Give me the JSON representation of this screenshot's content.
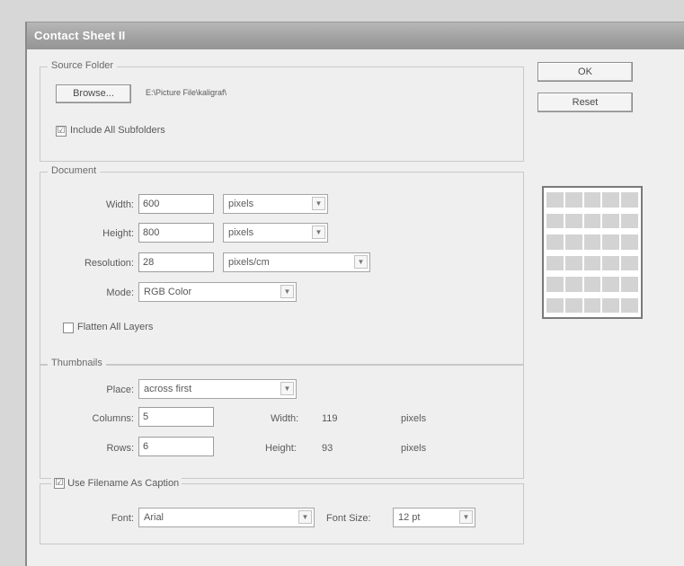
{
  "window": {
    "title": "Contact Sheet II"
  },
  "buttons": {
    "ok": "OK",
    "reset": "Reset"
  },
  "source_folder": {
    "legend": "Source Folder",
    "browse_label": "Browse...",
    "path": "E:\\Picture File\\kaligraf\\",
    "include_subfolders_label": "Include All Subfolders",
    "include_subfolders_checked": "☑"
  },
  "document": {
    "legend": "Document",
    "width_label": "Width:",
    "width_value": "600",
    "width_unit": "pixels",
    "height_label": "Height:",
    "height_value": "800",
    "height_unit": "pixels",
    "resolution_label": "Resolution:",
    "resolution_value": "28",
    "resolution_unit": "pixels/cm",
    "mode_label": "Mode:",
    "mode_value": "RGB Color",
    "flatten_label": "Flatten All Layers"
  },
  "thumbnails": {
    "legend": "Thumbnails",
    "place_label": "Place:",
    "place_value": "across first",
    "columns_label": "Columns:",
    "columns_value": "5",
    "rows_label": "Rows:",
    "rows_value": "6",
    "width_label": "Width:",
    "width_value": "119",
    "width_unit": "pixels",
    "height_label": "Height:",
    "height_value": "93",
    "height_unit": "pixels"
  },
  "caption": {
    "use_filename_label": "Use Filename As Caption",
    "use_filename_checked": "☑",
    "font_label": "Font:",
    "font_value": "Arial",
    "font_size_label": "Font Size:",
    "font_size_value": "12 pt"
  },
  "preview": {
    "columns": 5,
    "rows": 6
  }
}
